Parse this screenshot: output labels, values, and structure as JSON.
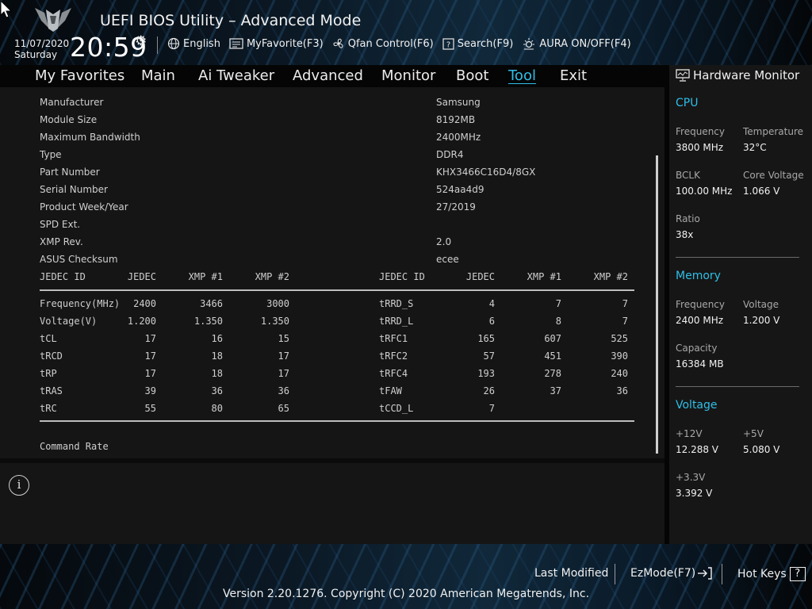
{
  "header": {
    "title": "UEFI BIOS Utility – Advanced Mode",
    "date": "11/07/2020",
    "day": "Saturday",
    "time": "20:59",
    "toolbar": [
      {
        "label": "English",
        "icon": "globe-icon"
      },
      {
        "label": "MyFavorite(F3)",
        "icon": "favorite-list-icon"
      },
      {
        "label": "Qfan Control(F6)",
        "icon": "fan-icon"
      },
      {
        "label": "Search(F9)",
        "icon": "search-question-icon"
      },
      {
        "label": "AURA ON/OFF(F4)",
        "icon": "aura-light-icon"
      }
    ]
  },
  "nav": {
    "items": [
      "My Favorites",
      "Main",
      "Ai Tweaker",
      "Advanced",
      "Monitor",
      "Boot",
      "Tool",
      "Exit"
    ],
    "active": "Tool"
  },
  "spd": {
    "fields": [
      {
        "label": "Manufacturer",
        "value": "Samsung"
      },
      {
        "label": "Module Size",
        "value": "8192MB"
      },
      {
        "label": "Maximum Bandwidth",
        "value": "2400MHz"
      },
      {
        "label": "Type",
        "value": "DDR4"
      },
      {
        "label": "Part Number",
        "value": "KHX3466C16D4/8GX"
      },
      {
        "label": "Serial Number",
        "value": "524aa4d9"
      },
      {
        "label": "Product Week/Year",
        "value": "27/2019"
      },
      {
        "label": "SPD Ext.",
        "value": ""
      },
      {
        "label": "XMP Rev.",
        "value": "2.0"
      },
      {
        "label": "ASUS Checksum",
        "value": "ecee"
      }
    ],
    "table": {
      "headers": [
        "JEDEC ID",
        "JEDEC",
        "XMP #1",
        "XMP #2"
      ],
      "left_rows": [
        [
          "Frequency(MHz)",
          "2400",
          "3466",
          "3000"
        ],
        [
          "Voltage(V)",
          "1.200",
          "1.350",
          "1.350"
        ],
        [
          "tCL",
          "17",
          "16",
          "15"
        ],
        [
          "tRCD",
          "17",
          "18",
          "17"
        ],
        [
          "tRP",
          "17",
          "18",
          "17"
        ],
        [
          "tRAS",
          "39",
          "36",
          "36"
        ],
        [
          "tRC",
          "55",
          "80",
          "65"
        ]
      ],
      "right_rows": [
        [
          "tRRD_S",
          "4",
          "7",
          "7"
        ],
        [
          "tRRD_L",
          "6",
          "8",
          "7"
        ],
        [
          "tRFC1",
          "165",
          "607",
          "525"
        ],
        [
          "tRFC2",
          "57",
          "451",
          "390"
        ],
        [
          "tRFC4",
          "193",
          "278",
          "240"
        ],
        [
          "tFAW",
          "26",
          "37",
          "36"
        ],
        [
          "tCCD_L",
          "7",
          "",
          ""
        ]
      ]
    },
    "command_rate_label": "Command Rate"
  },
  "hardware_monitor": {
    "title": "Hardware Monitor",
    "cpu": {
      "heading": "CPU",
      "frequency_label": "Frequency",
      "frequency": "3800 MHz",
      "temperature_label": "Temperature",
      "temperature": "32°C",
      "bclk_label": "BCLK",
      "bclk": "100.00 MHz",
      "core_voltage_label": "Core Voltage",
      "core_voltage": "1.066 V",
      "ratio_label": "Ratio",
      "ratio": "38x"
    },
    "memory": {
      "heading": "Memory",
      "frequency_label": "Frequency",
      "frequency": "2400 MHz",
      "voltage_label": "Voltage",
      "voltage": "1.200 V",
      "capacity_label": "Capacity",
      "capacity": "16384 MB"
    },
    "voltage": {
      "heading": "Voltage",
      "v12_label": "+12V",
      "v12": "12.288 V",
      "v5_label": "+5V",
      "v5": "5.080 V",
      "v33_label": "+3.3V",
      "v33": "3.392 V"
    }
  },
  "footer": {
    "last_modified": "Last Modified",
    "ezmode": "EzMode(F7)",
    "hot_keys": "Hot Keys",
    "hot_keys_badge": "?",
    "copyright": "Version 2.20.1276. Copyright (C) 2020 American Megatrends, Inc."
  },
  "colors": {
    "accent": "#2fbfe8",
    "panel": "#151515",
    "text": "#d8d8d8"
  }
}
